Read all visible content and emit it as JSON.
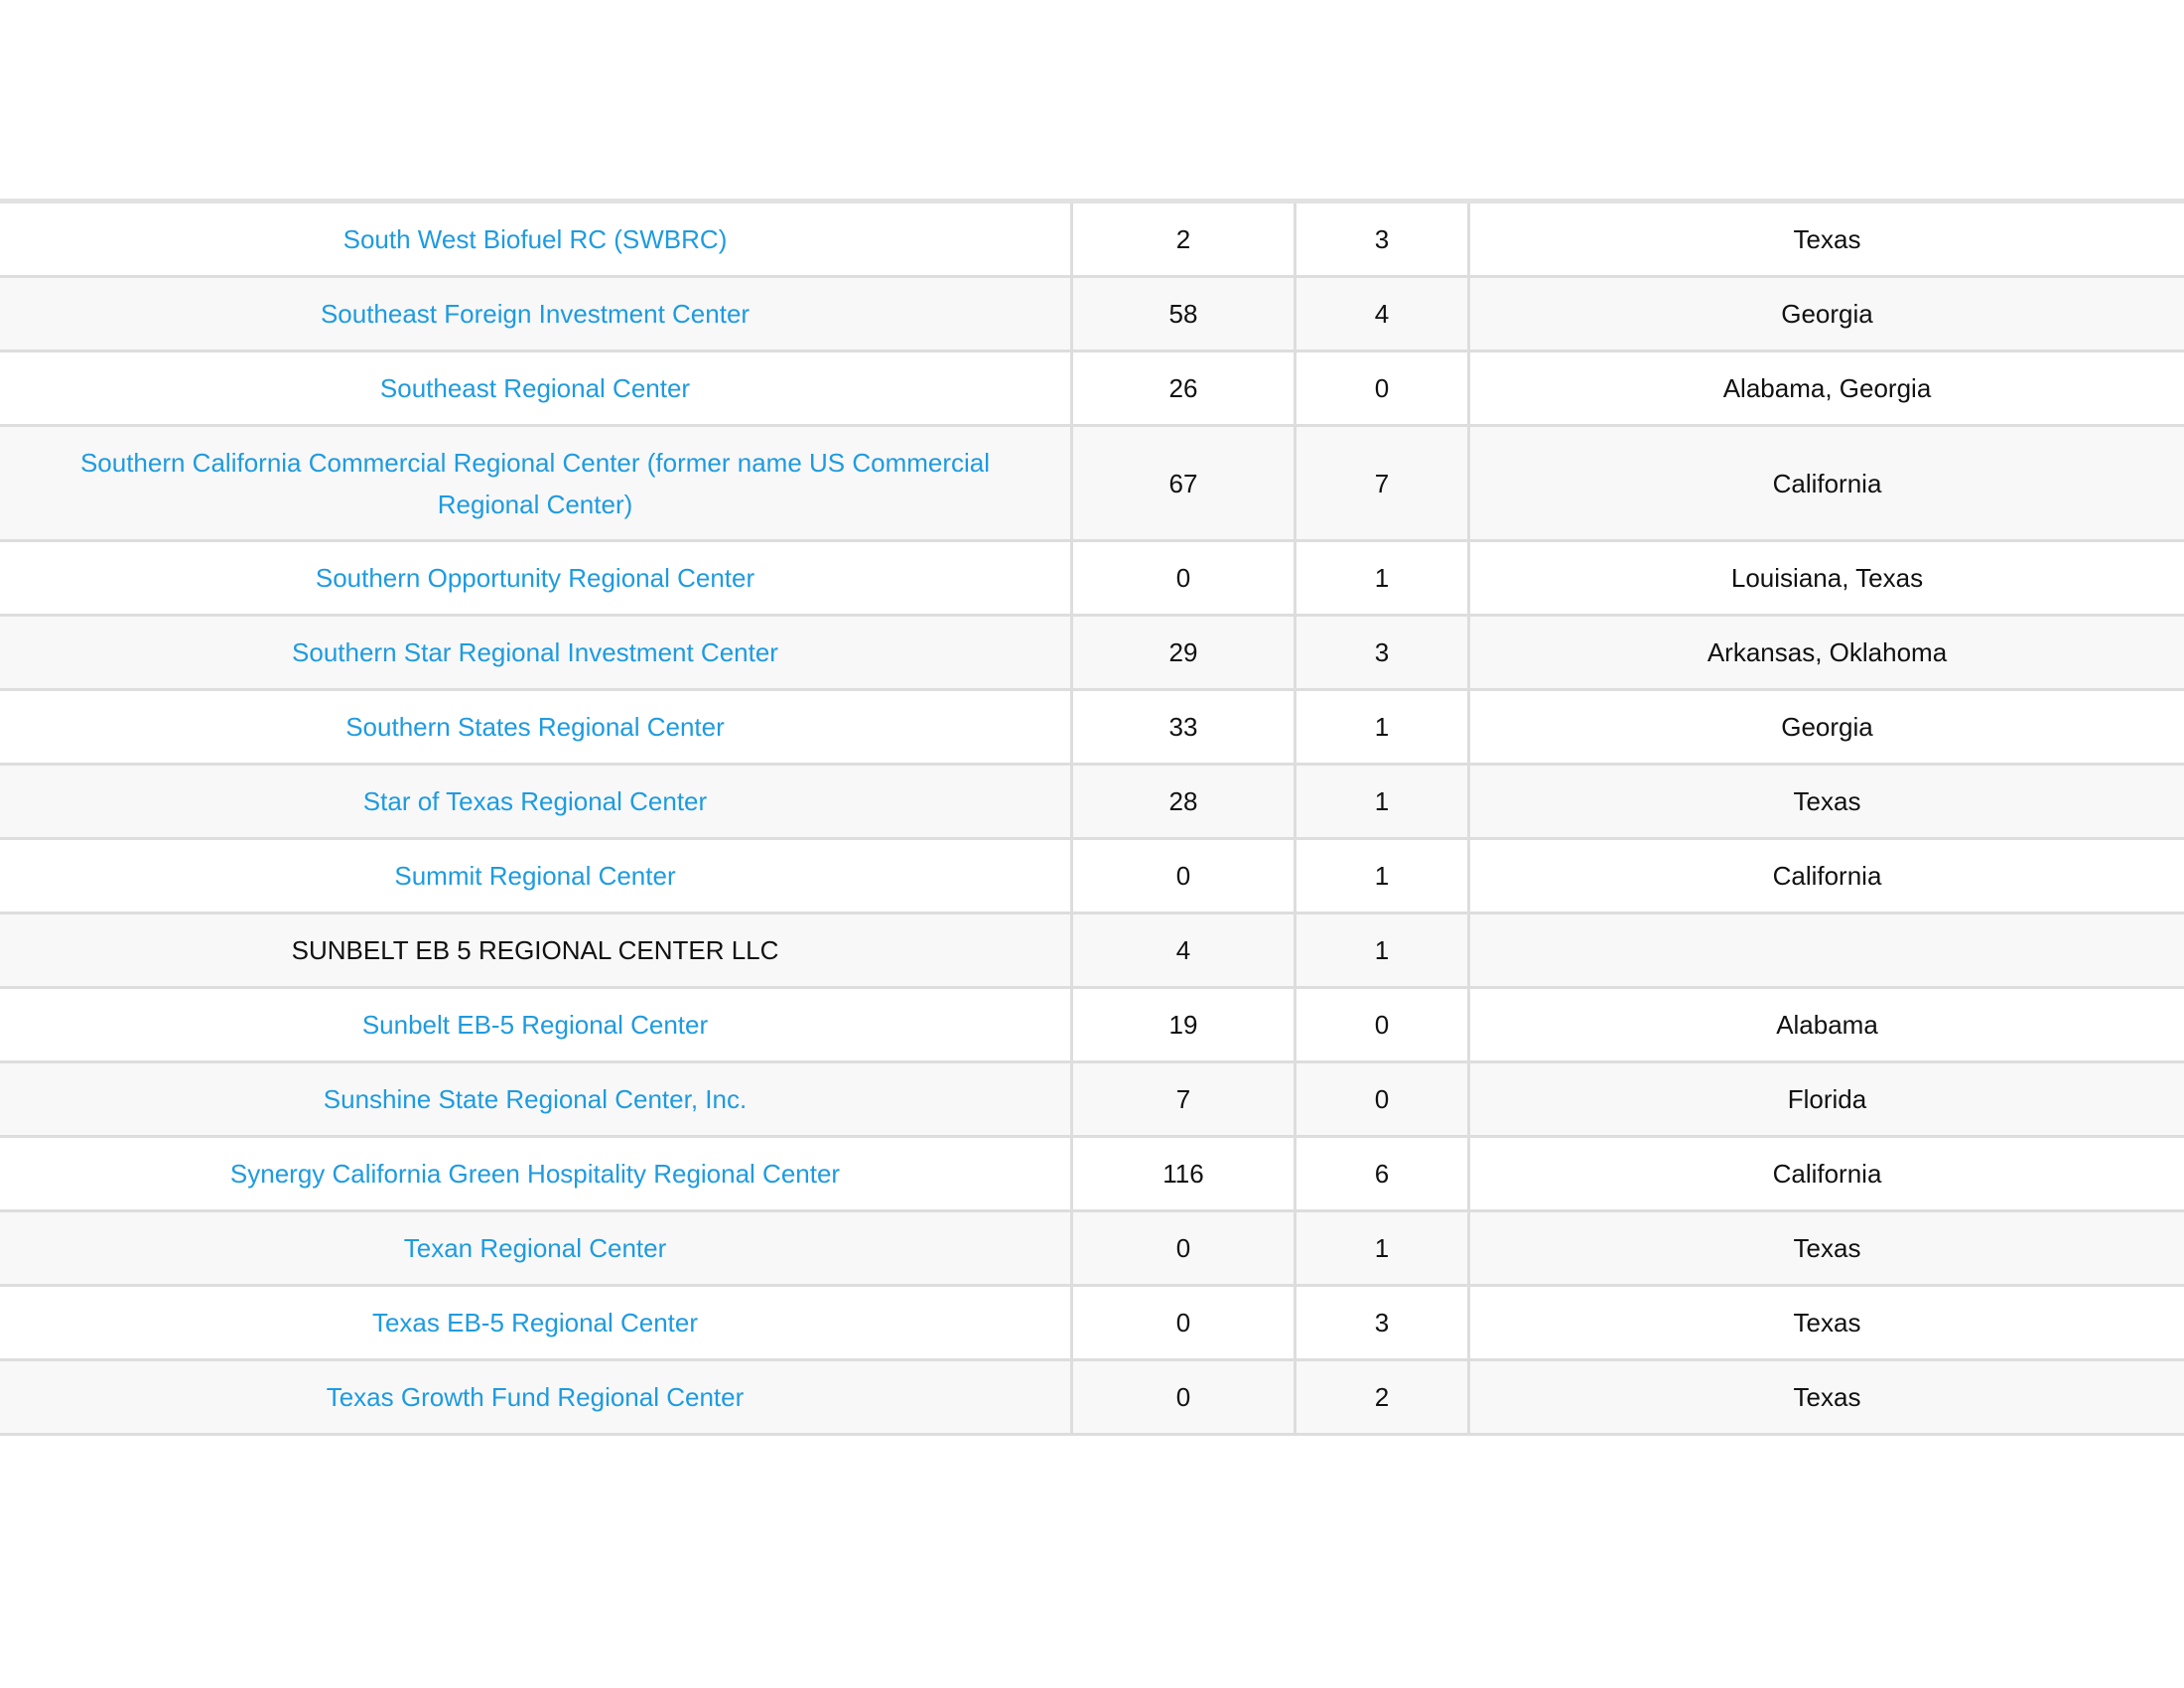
{
  "colors": {
    "link": "#1e9be0",
    "border": "#dddddd",
    "stripe": "#f8f8f8"
  },
  "rows": [
    {
      "name": "South West Biofuel RC (SWBRC)",
      "link": true,
      "col2": "2",
      "col3": "3",
      "state": "Texas"
    },
    {
      "name": "Southeast Foreign Investment Center",
      "link": true,
      "col2": "58",
      "col3": "4",
      "state": "Georgia"
    },
    {
      "name": "Southeast Regional Center",
      "link": true,
      "col2": "26",
      "col3": "0",
      "state": "Alabama, Georgia"
    },
    {
      "name": "Southern California Commercial Regional Center (former name US Commercial Regional Center)",
      "link": true,
      "col2": "67",
      "col3": "7",
      "state": "California"
    },
    {
      "name": "Southern Opportunity Regional Center",
      "link": true,
      "col2": "0",
      "col3": "1",
      "state": "Louisiana, Texas"
    },
    {
      "name": "Southern Star Regional Investment Center",
      "link": true,
      "col2": "29",
      "col3": "3",
      "state": "Arkansas, Oklahoma"
    },
    {
      "name": "Southern States Regional Center",
      "link": true,
      "col2": "33",
      "col3": "1",
      "state": "Georgia"
    },
    {
      "name": "Star of Texas Regional Center",
      "link": true,
      "col2": "28",
      "col3": "1",
      "state": "Texas"
    },
    {
      "name": "Summit Regional Center",
      "link": true,
      "col2": "0",
      "col3": "1",
      "state": "California"
    },
    {
      "name": "SUNBELT EB 5 REGIONAL CENTER LLC",
      "link": false,
      "col2": "4",
      "col3": "1",
      "state": ""
    },
    {
      "name": "Sunbelt EB-5 Regional Center",
      "link": true,
      "col2": "19",
      "col3": "0",
      "state": "Alabama"
    },
    {
      "name": "Sunshine State Regional Center, Inc.",
      "link": true,
      "col2": "7",
      "col3": "0",
      "state": "Florida"
    },
    {
      "name": "Synergy California Green Hospitality Regional Center",
      "link": true,
      "col2": "116",
      "col3": "6",
      "state": "California"
    },
    {
      "name": "Texan Regional Center",
      "link": true,
      "col2": "0",
      "col3": "1",
      "state": "Texas"
    },
    {
      "name": "Texas EB-5 Regional Center",
      "link": true,
      "col2": "0",
      "col3": "3",
      "state": "Texas"
    },
    {
      "name": "Texas Growth Fund Regional Center",
      "link": true,
      "col2": "0",
      "col3": "2",
      "state": "Texas"
    }
  ]
}
